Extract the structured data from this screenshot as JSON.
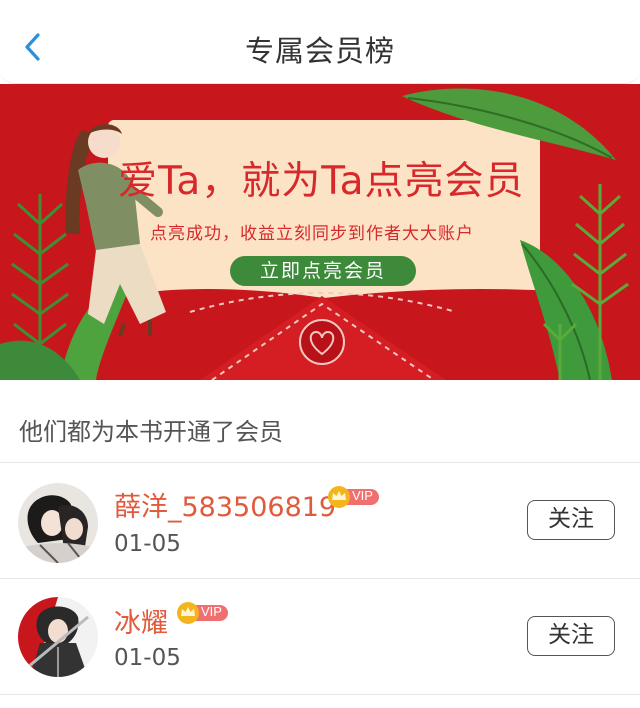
{
  "header": {
    "title": "专属会员榜",
    "back_icon": "chevron-left-icon"
  },
  "banner": {
    "headline": "爱Ta，就为Ta点亮会员",
    "subtitle": "点亮成功，收益立刻同步到作者大大账户",
    "cta_label": "立即点亮会员",
    "colors": {
      "background": "#c8161d",
      "card": "#fde3c6",
      "text": "#d7292c",
      "cta": "#3c8a3a",
      "leaf": "#3f9a3c"
    }
  },
  "section": {
    "title": "他们都为本书开通了会员"
  },
  "members": [
    {
      "name": "薛洋_583506819",
      "date": "01-05",
      "badge": "VIP",
      "follow_label": "关注"
    },
    {
      "name": "冰耀",
      "date": "01-05",
      "badge": "VIP",
      "follow_label": "关注"
    }
  ],
  "colors": {
    "name": "#e05a3c",
    "badge": "#f07070",
    "crown": "#f3b51d"
  }
}
